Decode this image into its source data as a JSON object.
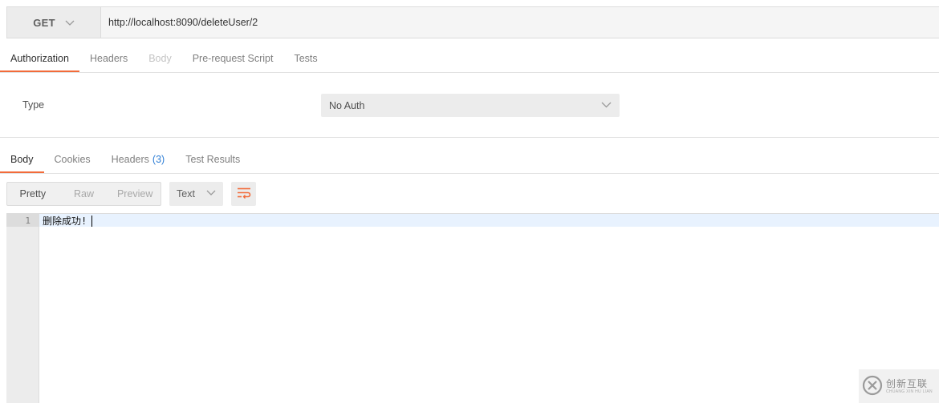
{
  "request": {
    "method": "GET",
    "url": "http://localhost:8090/deleteUser/2"
  },
  "request_tabs": [
    {
      "label": "Authorization",
      "state": "active"
    },
    {
      "label": "Headers",
      "state": "normal"
    },
    {
      "label": "Body",
      "state": "disabled"
    },
    {
      "label": "Pre-request Script",
      "state": "normal"
    },
    {
      "label": "Tests",
      "state": "normal"
    }
  ],
  "auth": {
    "type_label": "Type",
    "type_value": "No Auth"
  },
  "response_tabs": {
    "body": "Body",
    "cookies": "Cookies",
    "headers": "Headers",
    "headers_count": "(3)",
    "test_results": "Test Results"
  },
  "response_view": {
    "pretty": "Pretty",
    "raw": "Raw",
    "preview": "Preview",
    "format": "Text"
  },
  "editor": {
    "line_number": "1",
    "line_text": "删除成功!"
  },
  "watermark": {
    "text": "创新互联",
    "sub": "CHUANG XIN HU LIAN"
  },
  "colors": {
    "accent": "#f26b3a",
    "link": "#2f7fd6"
  }
}
